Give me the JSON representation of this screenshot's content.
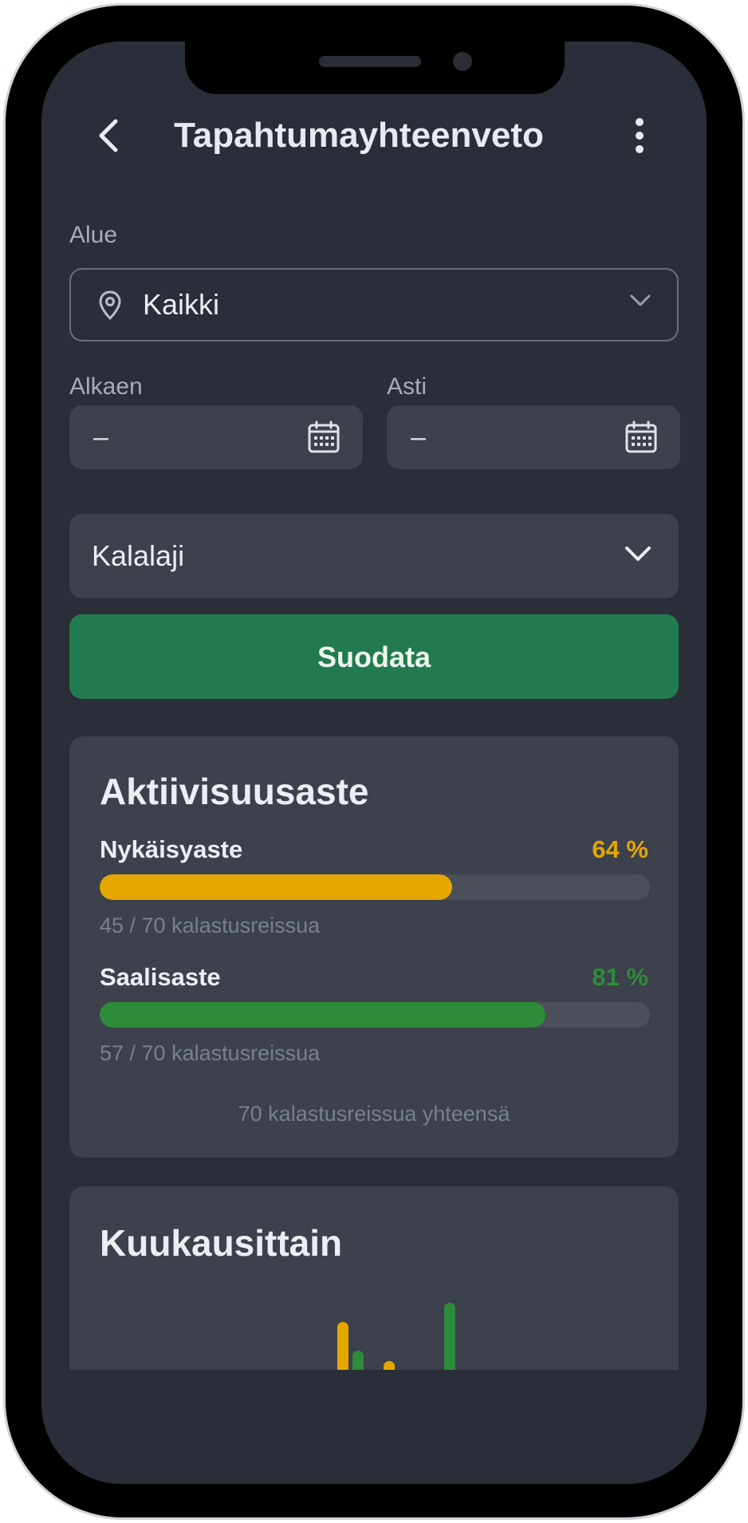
{
  "header": {
    "title": "Tapahtumayhteenveto"
  },
  "filters": {
    "area_label": "Alue",
    "area_value": "Kaikki",
    "from_label": "Alkaen",
    "from_value": "–",
    "to_label": "Asti",
    "to_value": "–",
    "species_value": "Kalalaji",
    "filter_button": "Suodata"
  },
  "activity": {
    "title": "Aktiivisuusaste",
    "metrics": [
      {
        "label": "Nykäisyaste",
        "percent_text": "64 %",
        "fraction": 0.64,
        "detail": "45 / 70 kalastusreissua",
        "color": "#e5a600"
      },
      {
        "label": "Saalisaste",
        "percent_text": "81 %",
        "fraction": 0.81,
        "detail": "57 / 70 kalastusreissua",
        "color": "#2e8b3a"
      }
    ],
    "total": "70 kalastusreissua yhteensä"
  },
  "monthly": {
    "title": "Kuukausittain"
  },
  "colors": {
    "background": "#2a2e38",
    "card": "#3c414b",
    "accent_green": "#227b4e",
    "bite_yellow": "#e5a600",
    "catch_green": "#2e8b3a"
  }
}
